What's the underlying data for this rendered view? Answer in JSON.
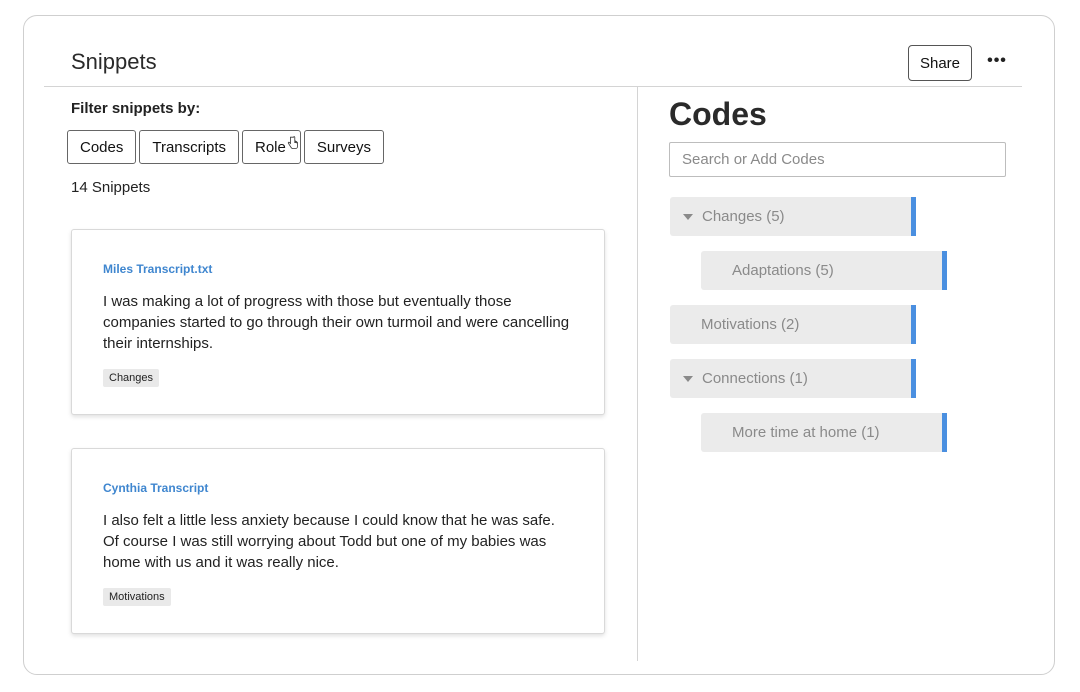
{
  "header": {
    "title": "Snippets",
    "share_label": "Share",
    "more_label": "•••"
  },
  "filters": {
    "label": "Filter snippets by:",
    "buttons": [
      "Codes",
      "Transcripts",
      "Role",
      "Surveys"
    ]
  },
  "snippets": {
    "count_label": "14 Snippets",
    "items": [
      {
        "source": "Miles Transcript.txt",
        "text": "I was making a lot of progress with those but eventually those companies started to go through their own turmoil and were cancelling their internships.",
        "tag": "Changes"
      },
      {
        "source": "Cynthia Transcript",
        "text": "I also felt a little less anxiety because I could know that he was safe. Of course I was still worrying about Todd but one of my babies was home with us and it was really nice.",
        "tag": "Motivations"
      }
    ]
  },
  "codes": {
    "title": "Codes",
    "search_placeholder": "Search or Add Codes",
    "items": [
      {
        "label": "Changes (5)",
        "level": 0,
        "expandable": true
      },
      {
        "label": "Adaptations (5)",
        "level": 1,
        "expandable": false
      },
      {
        "label": "Motivations (2)",
        "level": 0,
        "expandable": false
      },
      {
        "label": "Connections (1)",
        "level": 0,
        "expandable": true
      },
      {
        "label": "More time at home (1)",
        "level": 1,
        "expandable": false
      }
    ]
  },
  "colors": {
    "accent": "#4a8fe0",
    "link": "#3f86cf"
  }
}
